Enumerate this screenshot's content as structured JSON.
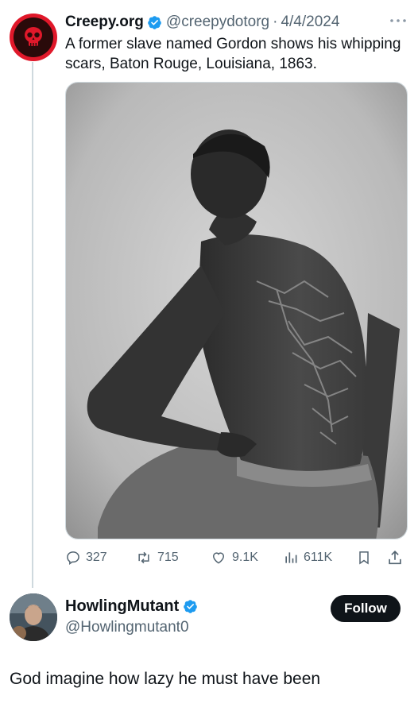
{
  "colors": {
    "accent_blue": "#1d9bf0",
    "avatar_red": "#e0182a",
    "text_primary": "#0f1419",
    "text_secondary": "#536471"
  },
  "original_post": {
    "author_name": "Creepy.org",
    "handle": "@creepydotorg",
    "separator": "·",
    "date": "4/4/2024",
    "text": "A former slave named Gordon shows his whipping scars, Baton Rouge, Louisiana, 1863.",
    "more_icon": "ellipsis-icon",
    "image_icon": "photo",
    "actions": {
      "replies": "327",
      "reposts": "715",
      "likes": "9.1K",
      "views": "611K"
    }
  },
  "reply": {
    "author_name": "HowlingMutant",
    "handle": "@Howlingmutant0",
    "follow_label": "Follow",
    "text": "God imagine how lazy he must have been"
  }
}
